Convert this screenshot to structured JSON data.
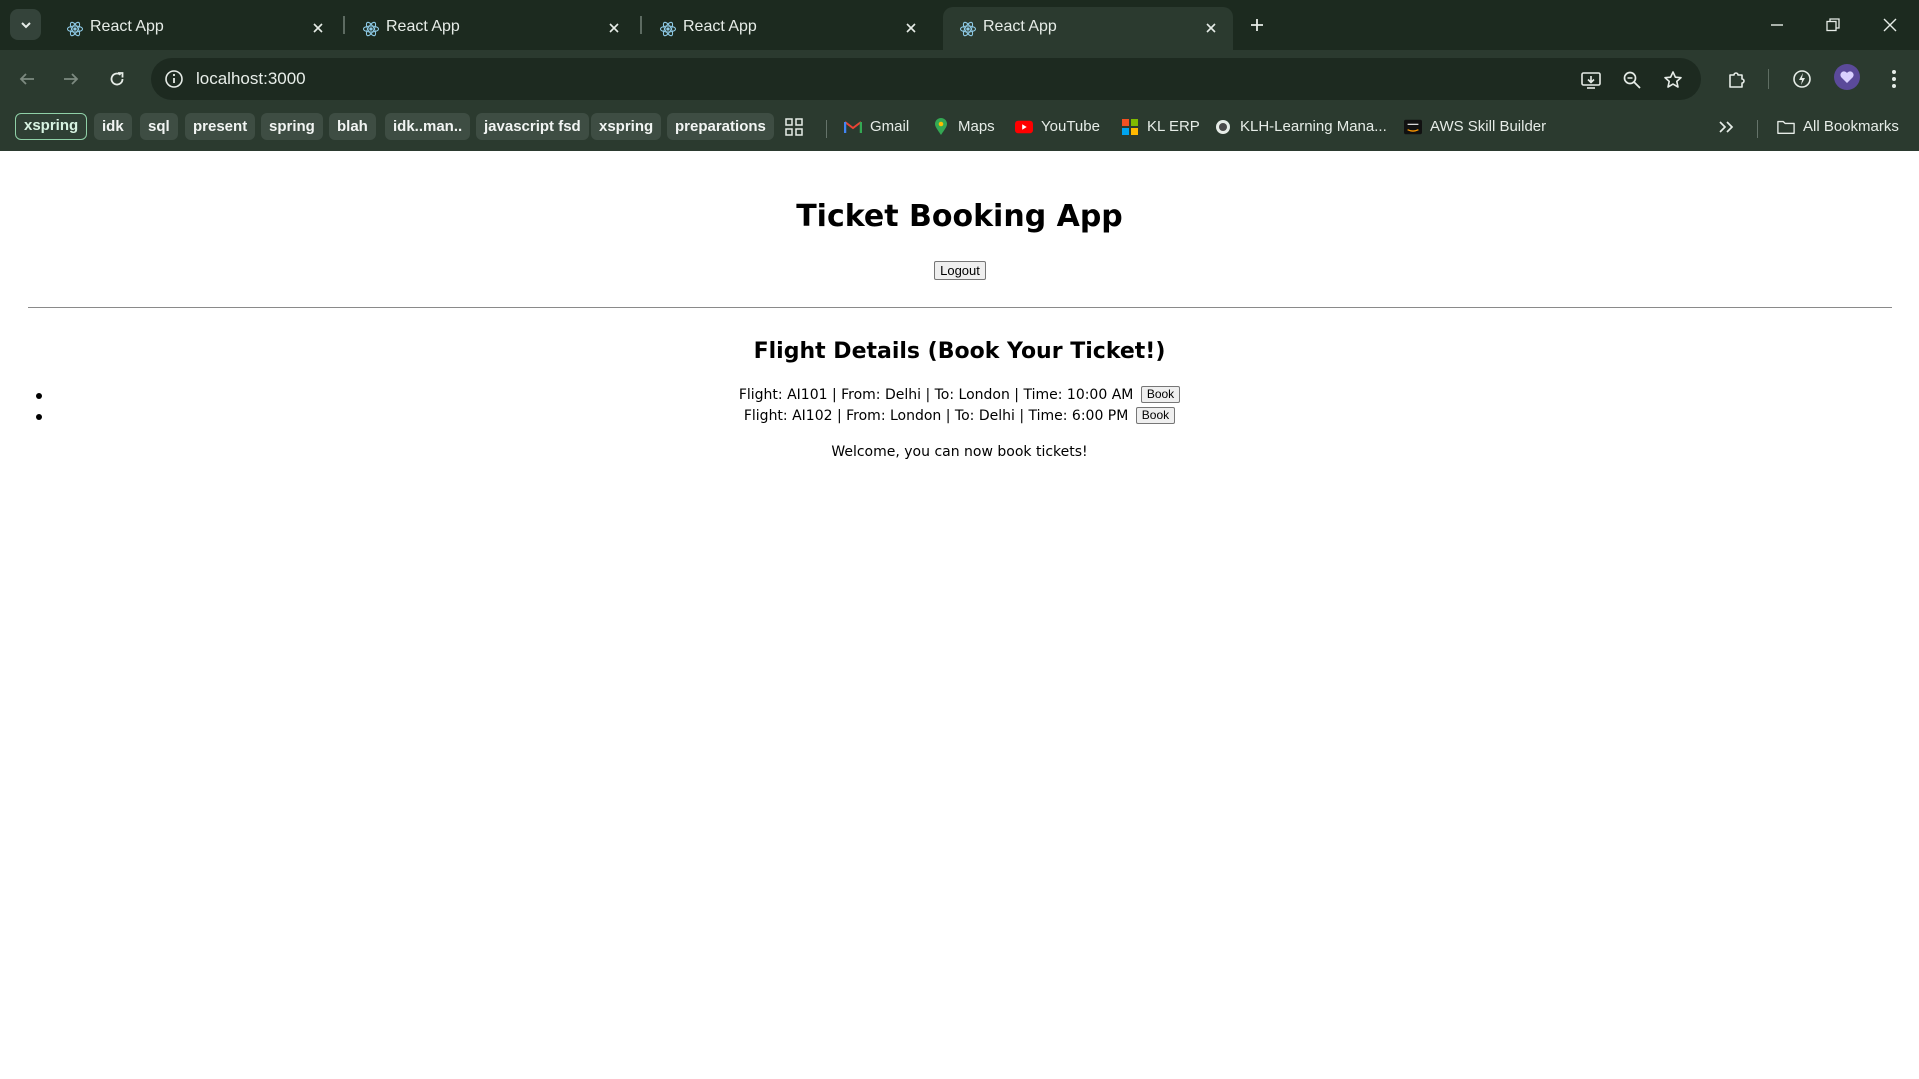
{
  "browser": {
    "tabs": [
      {
        "title": "React App",
        "active": false
      },
      {
        "title": "React App",
        "active": false
      },
      {
        "title": "React App",
        "active": false
      },
      {
        "title": "React App",
        "active": true
      }
    ],
    "url": "localhost:3000",
    "bookmarks": {
      "chips": [
        "xspring",
        "idk",
        "sql",
        "present",
        "spring",
        "blah",
        "idk..man..",
        "javascript fsd",
        "xspring",
        "preparations"
      ],
      "links": [
        "Gmail",
        "Maps",
        "YouTube",
        "KL ERP",
        "KLH-Learning Mana...",
        "AWS Skill Builder"
      ],
      "all_bookmarks": "All Bookmarks"
    },
    "colors": {
      "frame": "#1c2a1f",
      "toolbar": "#2b3a2f",
      "accent": "#8fd0a7"
    }
  },
  "app": {
    "title": "Ticket Booking App",
    "logout_label": "Logout",
    "section_title": "Flight Details (Book Your Ticket!)",
    "flights": [
      {
        "text": "Flight: AI101 | From: Delhi | To: London | Time: 10:00 AM",
        "button": "Book"
      },
      {
        "text": "Flight: AI102 | From: London | To: Delhi | Time: 6:00 PM",
        "button": "Book"
      }
    ],
    "welcome": "Welcome, you can now book tickets!"
  }
}
